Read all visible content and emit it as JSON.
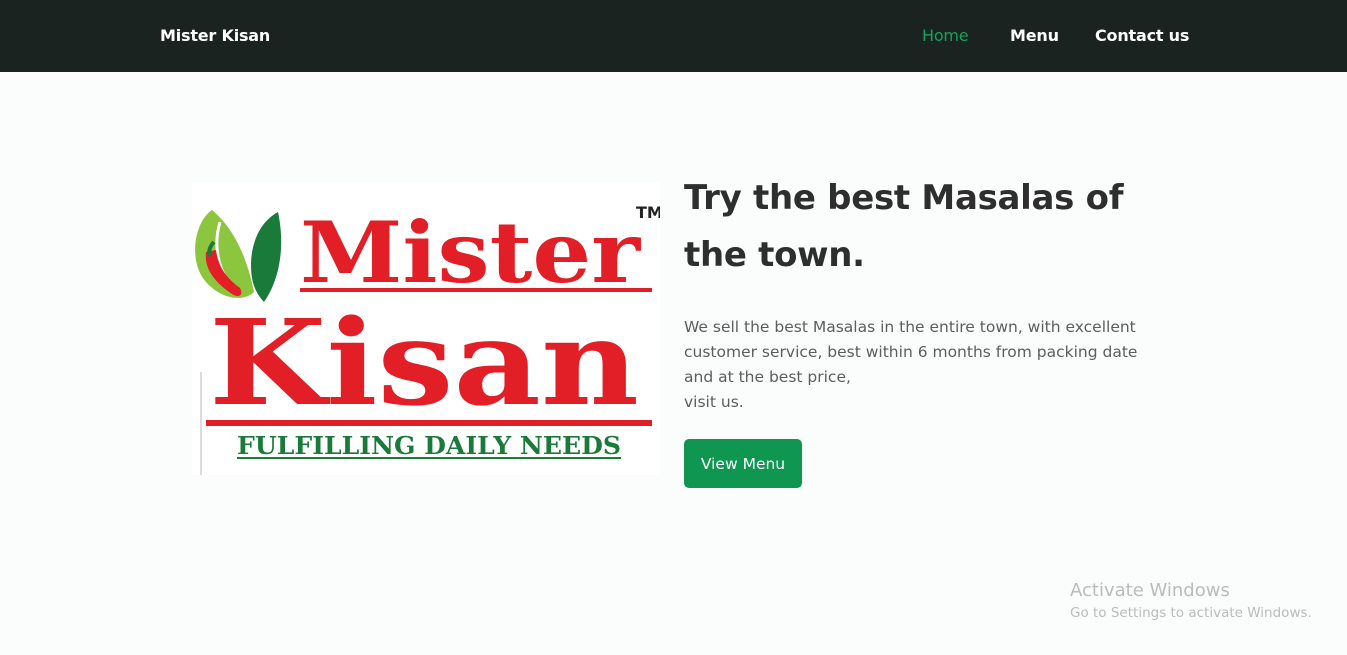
{
  "navbar": {
    "brand": "Mister Kisan",
    "links": [
      {
        "label": "Home",
        "active": true
      },
      {
        "label": "Menu",
        "active": false
      },
      {
        "label": "Contact us",
        "active": false
      }
    ]
  },
  "hero": {
    "logo": {
      "word1": "Mister",
      "word2": "Kisan",
      "tm": "TM",
      "tagline": "FULFILLING DAILY NEEDS"
    },
    "title_line1": "Try the best Masalas of",
    "title_line2": "the town.",
    "text_line1": "We sell the best Masalas in the entire town, with excellent",
    "text_line2": "customer service, best within 6 months from packing date",
    "text_line3": "and at the best price,",
    "text_line4": "visit us.",
    "button_label": "View Menu"
  },
  "watermark": {
    "title": "Activate Windows",
    "subtitle": "Go to Settings to activate Windows."
  },
  "colors": {
    "navbar_bg": "#1b2320",
    "active_link": "#14a25c",
    "button_bg": "#0f9650",
    "logo_red": "#e21f26",
    "logo_green": "#1a7a3a"
  }
}
